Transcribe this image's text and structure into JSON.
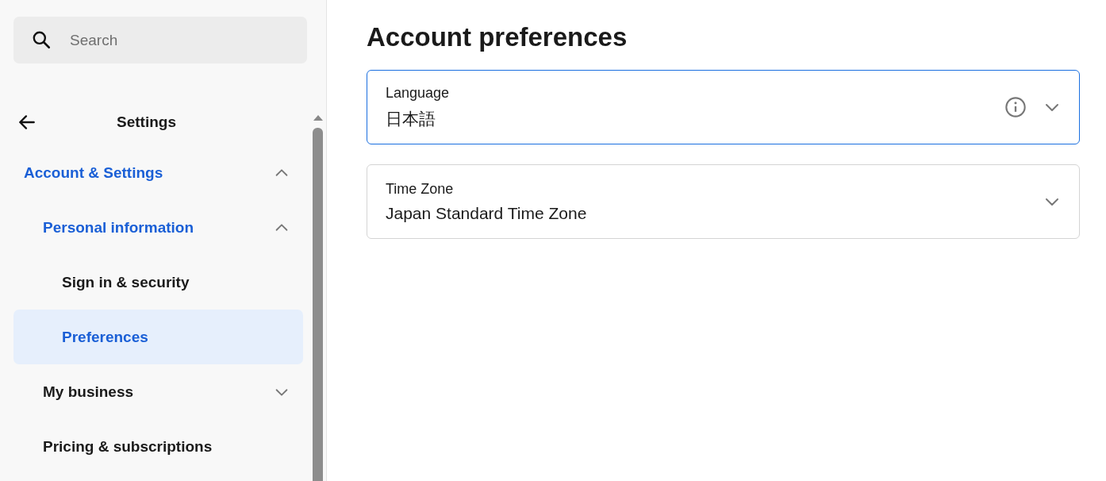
{
  "sidebar": {
    "search": {
      "placeholder": "Search"
    },
    "header": {
      "title": "Settings"
    },
    "items": [
      {
        "label": "Account & Settings",
        "selected": false,
        "expanded": true,
        "children": [
          {
            "label": "Personal information",
            "selected": false,
            "expanded": true,
            "children": [
              {
                "label": "Sign in & security",
                "selected": false
              },
              {
                "label": "Preferences",
                "selected": true
              }
            ]
          },
          {
            "label": "My business",
            "selected": false,
            "expanded": false
          },
          {
            "label": "Pricing & subscriptions",
            "selected": false
          }
        ]
      }
    ]
  },
  "main": {
    "title": "Account preferences",
    "fields": [
      {
        "label": "Language",
        "value": "日本語",
        "focused": true,
        "info": true
      },
      {
        "label": "Time Zone",
        "value": "Japan Standard Time Zone",
        "focused": false,
        "info": false
      }
    ]
  }
}
